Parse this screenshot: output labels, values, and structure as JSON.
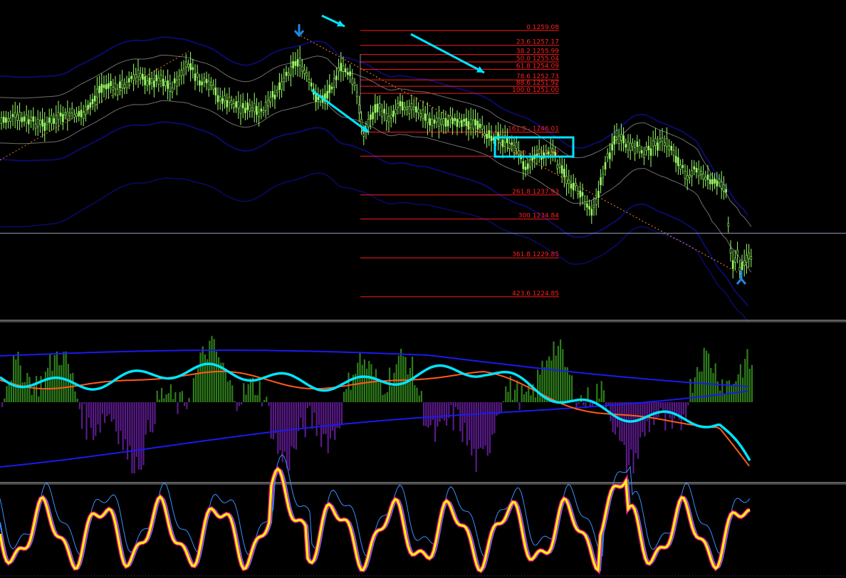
{
  "chart_data": [
    {
      "type": "candlestick",
      "panel": "price",
      "grid": false,
      "trend_series": [
        [
          120,
          20
        ],
        [
          140,
          55
        ],
        [
          150,
          60
        ],
        [
          165,
          55
        ],
        [
          185,
          70
        ],
        [
          200,
          75
        ],
        [
          210,
          62
        ],
        [
          225,
          72
        ],
        [
          240,
          55
        ],
        [
          255,
          75
        ],
        [
          265,
          90
        ],
        [
          280,
          65
        ],
        [
          295,
          60
        ],
        [
          310,
          40
        ],
        [
          325,
          35
        ],
        [
          340,
          30
        ],
        [
          355,
          25
        ],
        [
          365,
          20
        ],
        [
          375,
          30
        ],
        [
          390,
          55
        ],
        [
          405,
          80
        ],
        [
          418,
          95
        ],
        [
          425,
          82
        ],
        [
          432,
          70
        ],
        [
          440,
          50
        ],
        [
          450,
          40
        ],
        [
          460,
          48
        ],
        [
          470,
          70
        ],
        [
          478,
          82
        ],
        [
          485,
          84
        ],
        [
          492,
          72
        ],
        [
          500,
          55
        ],
        [
          505,
          20
        ],
        [
          512,
          -10
        ],
        [
          520,
          15
        ],
        [
          530,
          30
        ],
        [
          540,
          20
        ],
        [
          548,
          15
        ],
        [
          560,
          35
        ],
        [
          575,
          30
        ],
        [
          590,
          20
        ],
        [
          605,
          10
        ],
        [
          620,
          8
        ],
        [
          635,
          12
        ],
        [
          650,
          10
        ],
        [
          665,
          5
        ],
        [
          680,
          -5
        ],
        [
          695,
          -12
        ],
        [
          705,
          -18
        ],
        [
          718,
          -22
        ],
        [
          728,
          -30
        ],
        [
          735,
          -55
        ],
        [
          745,
          -45
        ],
        [
          755,
          -35
        ],
        [
          765,
          -40
        ],
        [
          775,
          -30
        ],
        [
          785,
          -55
        ],
        [
          795,
          -70
        ],
        [
          805,
          -80
        ],
        [
          815,
          -90
        ],
        [
          822,
          -105
        ],
        [
          830,
          -115
        ],
        [
          840,
          -95
        ],
        [
          850,
          -50
        ],
        [
          858,
          -30
        ],
        [
          865,
          -10
        ],
        [
          875,
          -20
        ],
        [
          885,
          -30
        ],
        [
          895,
          -25
        ],
        [
          905,
          -35
        ],
        [
          915,
          -28
        ],
        [
          925,
          -20
        ],
        [
          935,
          -22
        ],
        [
          945,
          -30
        ],
        [
          955,
          -55
        ],
        [
          965,
          -65
        ],
        [
          975,
          -60
        ],
        [
          985,
          -65
        ],
        [
          995,
          -70
        ],
        [
          1005,
          -80
        ],
        [
          1015,
          -75
        ],
        [
          1020,
          -90
        ],
        [
          1025,
          -170
        ],
        [
          1030,
          -190
        ],
        [
          1035,
          -175
        ],
        [
          1040,
          -205
        ],
        [
          1045,
          -185
        ],
        [
          1050,
          -180
        ],
        [
          1055,
          -182
        ]
      ],
      "y_range": [
        1222.0,
        1263.0
      ],
      "fibonacci_levels": [
        {
          "label": "0 1259.08",
          "value": 1259.08
        },
        {
          "label": "23.6 1257.17",
          "value": 1257.17
        },
        {
          "label": "38.2 1255.99",
          "value": 1255.99
        },
        {
          "label": "50.0 1255.04",
          "value": 1255.04
        },
        {
          "label": "61.8 1254.09",
          "value": 1254.09
        },
        {
          "label": "78.6 1252.73",
          "value": 1252.73
        },
        {
          "label": "88.6 1251.92",
          "value": 1251.92
        },
        {
          "label": "100.0 1251.00",
          "value": 1251.0
        },
        {
          "label": "161.8 - 1246.01",
          "value": 1246.01
        },
        {
          "label": "200 - 1242.92",
          "value": 1242.92
        },
        {
          "label": "261.8 1237.93",
          "value": 1237.93
        },
        {
          "label": "300 1234.84",
          "value": 1234.84
        },
        {
          "label": "361.8 1229.85",
          "value": 1229.85
        },
        {
          "label": "423.6 1224.85",
          "value": 1224.85
        }
      ],
      "current_price_line": 1233.0,
      "colors": {
        "candles": "#9aff66",
        "bands": "#9e9e9e",
        "channel": "#0a0a6a",
        "fib": "#ff1a1a",
        "highlight": "#00e5ff",
        "arrows": "#1e88e5",
        "trendline": "#ff8c1a"
      }
    },
    {
      "type": "bar+line",
      "panel": "momentum",
      "histogram_colors": {
        "positive": "#2e7d1a",
        "negative": "#5a1a8a"
      },
      "line_colors": {
        "main": "#00e5ff",
        "signal": "#ff5a1a",
        "bands": "#1a1aee"
      }
    },
    {
      "type": "line",
      "panel": "oscillator",
      "line_colors": {
        "main": "#ffff00",
        "markers": "#ff1aa0",
        "secondary": "#3a8fff"
      }
    }
  ]
}
